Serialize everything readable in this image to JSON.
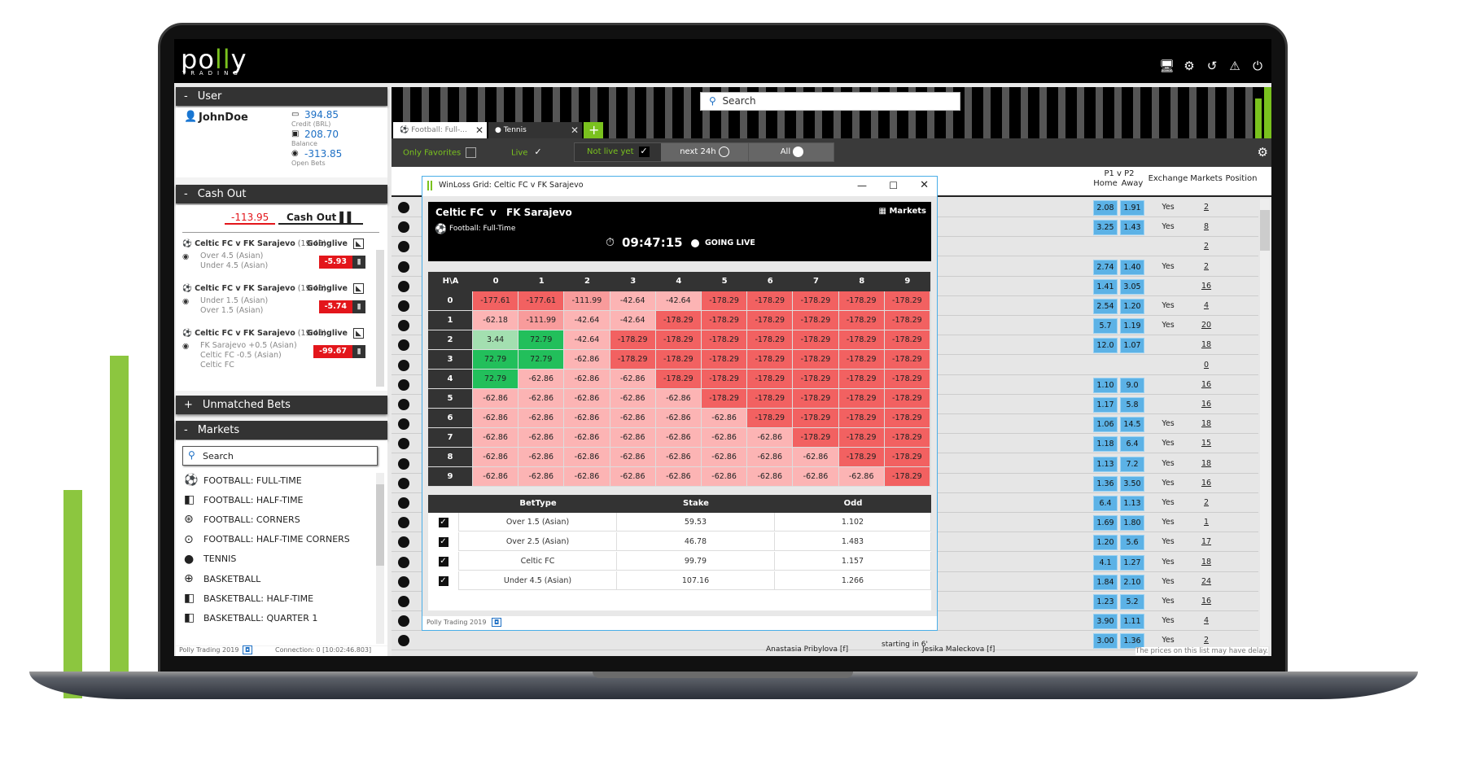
{
  "brand": {
    "logo": "polly",
    "sub": "TRADING",
    "accent": "#7ac21e"
  },
  "top_icons": [
    "monitor-settings-icon",
    "gear-icon",
    "history-icon",
    "warning-icon",
    "power-icon"
  ],
  "user": {
    "header": "User",
    "toggle": "-",
    "name": "JohnDoe",
    "credit": "394.85",
    "credit_label": "Credit  (BRL)",
    "balance": "208.70",
    "balance_label": "Balance",
    "open_bets": "-313.85",
    "open_bets_label": "Open Bets"
  },
  "cashout": {
    "header": "Cash Out",
    "toggle": "-",
    "amount": "-113.95",
    "button": "Cash Out",
    "bets": [
      {
        "event": "Celtic FC v FK Sarajevo",
        "time": "(19:45)",
        "status": "Goinglive",
        "lines": [
          "Over 4.5 (Asian)",
          "Under 4.5 (Asian)"
        ],
        "value": "-5.93"
      },
      {
        "event": "Celtic FC v FK Sarajevo",
        "time": "(19:45)",
        "status": "Goinglive",
        "lines": [
          "Under 1.5 (Asian)",
          "Over 1.5 (Asian)"
        ],
        "value": "-5.74"
      },
      {
        "event": "Celtic FC v FK Sarajevo",
        "time": "(19:45)",
        "status": "Goinglive",
        "lines": [
          "FK Sarajevo +0.5 (Asian)",
          "Celtic FC -0.5 (Asian)",
          "Celtic FC"
        ],
        "value": "-99.67"
      }
    ]
  },
  "unmatched": {
    "header": "Unmatched Bets",
    "toggle": "+"
  },
  "markets": {
    "header": "Markets",
    "toggle": "-",
    "search_placeholder": "Search",
    "items": [
      {
        "label": "FOOTBALL: FULL-TIME",
        "icon": "football-icon"
      },
      {
        "label": "FOOTBALL: HALF-TIME",
        "icon": "football-half-icon"
      },
      {
        "label": "FOOTBALL: CORNERS",
        "icon": "football-corners-icon"
      },
      {
        "label": "FOOTBALL: HALF-TIME CORNERS",
        "icon": "football-half-corners-icon"
      },
      {
        "label": "TENNIS",
        "icon": "tennis-icon"
      },
      {
        "label": "BASKETBALL",
        "icon": "basketball-icon"
      },
      {
        "label": "BASKETBALL: HALF-TIME",
        "icon": "basketball-half-icon"
      },
      {
        "label": "BASKETBALL: QUARTER 1",
        "icon": "basketball-quarter-icon"
      }
    ]
  },
  "left_footer": {
    "copyright": "Polly Trading 2019",
    "connection": "Connection: 0 [10:02:46.803]"
  },
  "top_search_placeholder": "Search",
  "tabs": [
    {
      "label": "Football: Full-...",
      "active": true
    },
    {
      "label": "Tennis",
      "active": false
    }
  ],
  "filters": {
    "only_favorites": "Only Favorites",
    "only_favorites_checked": false,
    "live": "Live",
    "live_checked": true,
    "not_live_yet": "Not live yet",
    "not_live_yet_checked": true,
    "next24": "next 24h",
    "all": "All",
    "selected": "All"
  },
  "list_header": {
    "p1p2": "P1 v P2",
    "home": "Home",
    "away": "Away",
    "exchange": "Exchange",
    "markets": "Markets",
    "position": "Position"
  },
  "list_rows": [
    [
      "2.08",
      "1.91",
      "Yes",
      "2"
    ],
    [
      "3.25",
      "1.43",
      "Yes",
      "8"
    ],
    [
      "",
      "",
      "",
      "2"
    ],
    [
      "2.74",
      "1.40",
      "Yes",
      "2"
    ],
    [
      "1.41",
      "3.05",
      "",
      "16"
    ],
    [
      "2.54",
      "1.20",
      "Yes",
      "4"
    ],
    [
      "5.7",
      "1.19",
      "Yes",
      "20"
    ],
    [
      "12.0",
      "1.07",
      "",
      "18"
    ],
    [
      "",
      "",
      "",
      "0"
    ],
    [
      "1.10",
      "9.0",
      "",
      "16"
    ],
    [
      "1.17",
      "5.8",
      "",
      "16"
    ],
    [
      "1.06",
      "14.5",
      "Yes",
      "18"
    ],
    [
      "1.18",
      "6.4",
      "Yes",
      "15"
    ],
    [
      "1.13",
      "7.2",
      "Yes",
      "18"
    ],
    [
      "1.36",
      "3.50",
      "Yes",
      "16"
    ],
    [
      "6.4",
      "1.13",
      "Yes",
      "2"
    ],
    [
      "1.69",
      "1.80",
      "Yes",
      "1"
    ],
    [
      "1.20",
      "5.6",
      "Yes",
      "17"
    ],
    [
      "4.1",
      "1.27",
      "Yes",
      "18"
    ],
    [
      "1.84",
      "2.10",
      "Yes",
      "24"
    ],
    [
      "1.23",
      "5.2",
      "Yes",
      "16"
    ],
    [
      "3.90",
      "1.11",
      "Yes",
      "4"
    ],
    [
      "3.00",
      "1.36",
      "Yes",
      "2"
    ]
  ],
  "list_bottom": {
    "home_player": "Anastasia Pribylova [f]",
    "starting": "starting in 6'",
    "away_player": "Jesika Maleckova [f]",
    "disclaimer": "The prices on this list may have delay."
  },
  "winloss": {
    "title": "WinLoss Grid: Celtic FC v FK Sarajevo",
    "home": "Celtic FC",
    "vs": "v",
    "away": "FK Sarajevo",
    "market": "Football: Full-Time",
    "markets_button": "Markets",
    "clock": "09:47:15",
    "status": "GOING LIVE",
    "corner": "H\\A",
    "cols": [
      "0",
      "1",
      "2",
      "3",
      "4",
      "5",
      "6",
      "7",
      "8",
      "9"
    ],
    "grid": [
      [
        "-177.61",
        "-177.61",
        "-111.99",
        "-42.64",
        "-42.64",
        "-178.29",
        "-178.29",
        "-178.29",
        "-178.29",
        "-178.29"
      ],
      [
        "-62.18",
        "-111.99",
        "-42.64",
        "-42.64",
        "-178.29",
        "-178.29",
        "-178.29",
        "-178.29",
        "-178.29",
        "-178.29"
      ],
      [
        "3.44",
        "72.79",
        "-42.64",
        "-178.29",
        "-178.29",
        "-178.29",
        "-178.29",
        "-178.29",
        "-178.29",
        "-178.29"
      ],
      [
        "72.79",
        "72.79",
        "-62.86",
        "-178.29",
        "-178.29",
        "-178.29",
        "-178.29",
        "-178.29",
        "-178.29",
        "-178.29"
      ],
      [
        "72.79",
        "-62.86",
        "-62.86",
        "-62.86",
        "-178.29",
        "-178.29",
        "-178.29",
        "-178.29",
        "-178.29",
        "-178.29"
      ],
      [
        "-62.86",
        "-62.86",
        "-62.86",
        "-62.86",
        "-62.86",
        "-178.29",
        "-178.29",
        "-178.29",
        "-178.29",
        "-178.29"
      ],
      [
        "-62.86",
        "-62.86",
        "-62.86",
        "-62.86",
        "-62.86",
        "-62.86",
        "-178.29",
        "-178.29",
        "-178.29",
        "-178.29"
      ],
      [
        "-62.86",
        "-62.86",
        "-62.86",
        "-62.86",
        "-62.86",
        "-62.86",
        "-62.86",
        "-178.29",
        "-178.29",
        "-178.29"
      ],
      [
        "-62.86",
        "-62.86",
        "-62.86",
        "-62.86",
        "-62.86",
        "-62.86",
        "-62.86",
        "-62.86",
        "-178.29",
        "-178.29"
      ],
      [
        "-62.86",
        "-62.86",
        "-62.86",
        "-62.86",
        "-62.86",
        "-62.86",
        "-62.86",
        "-62.86",
        "-62.86",
        "-178.29"
      ]
    ],
    "bets_header": [
      "BetType",
      "Stake",
      "Odd"
    ],
    "bets": [
      {
        "type": "Over 1.5 (Asian)",
        "stake": "59.53",
        "odd": "1.102",
        "checked": true
      },
      {
        "type": "Over 2.5 (Asian)",
        "stake": "46.78",
        "odd": "1.483",
        "checked": true
      },
      {
        "type": "Celtic FC",
        "stake": "99.79",
        "odd": "1.157",
        "checked": true
      },
      {
        "type": "Under 4.5 (Asian)",
        "stake": "107.16",
        "odd": "1.266",
        "checked": true
      }
    ],
    "footer": "Polly Trading 2019"
  },
  "colors": {
    "loss_strong": "#f26161",
    "loss_mid": "#f89b9b",
    "loss_light": "#fcb4b4",
    "win_light": "#a3dfb0",
    "win_strong": "#22bf5b",
    "odds_blue": "#5cb2e6"
  }
}
